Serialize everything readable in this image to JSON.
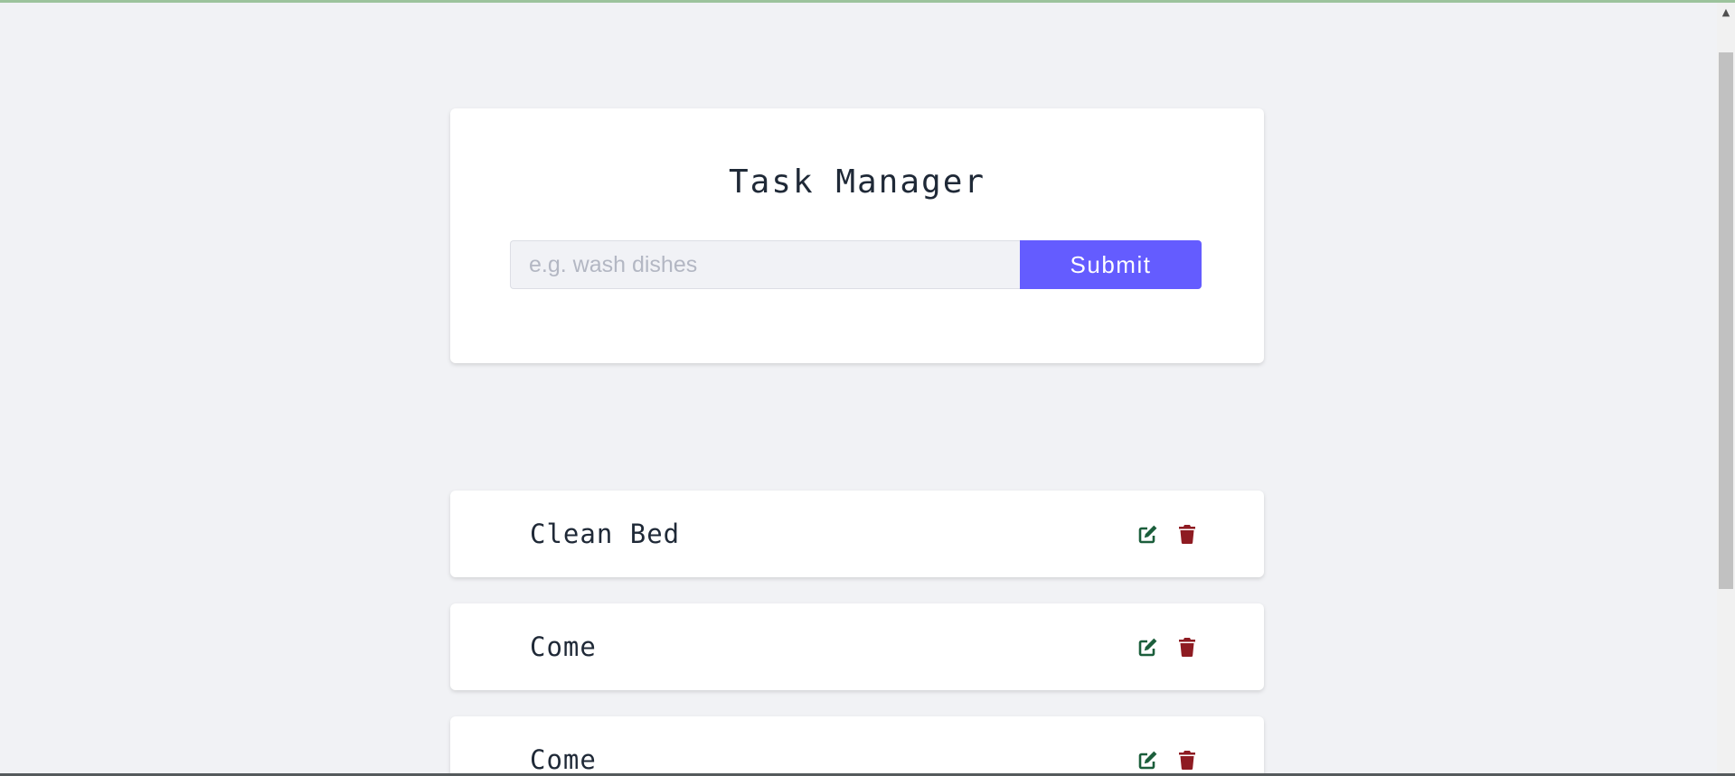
{
  "app": {
    "title": "Task Manager"
  },
  "form": {
    "input_placeholder": "e.g. wash dishes",
    "input_value": "",
    "submit_label": "Submit"
  },
  "tasks": [
    {
      "name": "Clean Bed"
    },
    {
      "name": "Come"
    },
    {
      "name": "Come"
    }
  ],
  "icons": {
    "edit": "edit-icon",
    "delete": "trash-icon"
  },
  "colors": {
    "background": "#f1f2f5",
    "accent": "#645cff",
    "edit_icon": "#1b5e3b",
    "delete_icon": "#8e1b22",
    "text": "#1f2937"
  }
}
